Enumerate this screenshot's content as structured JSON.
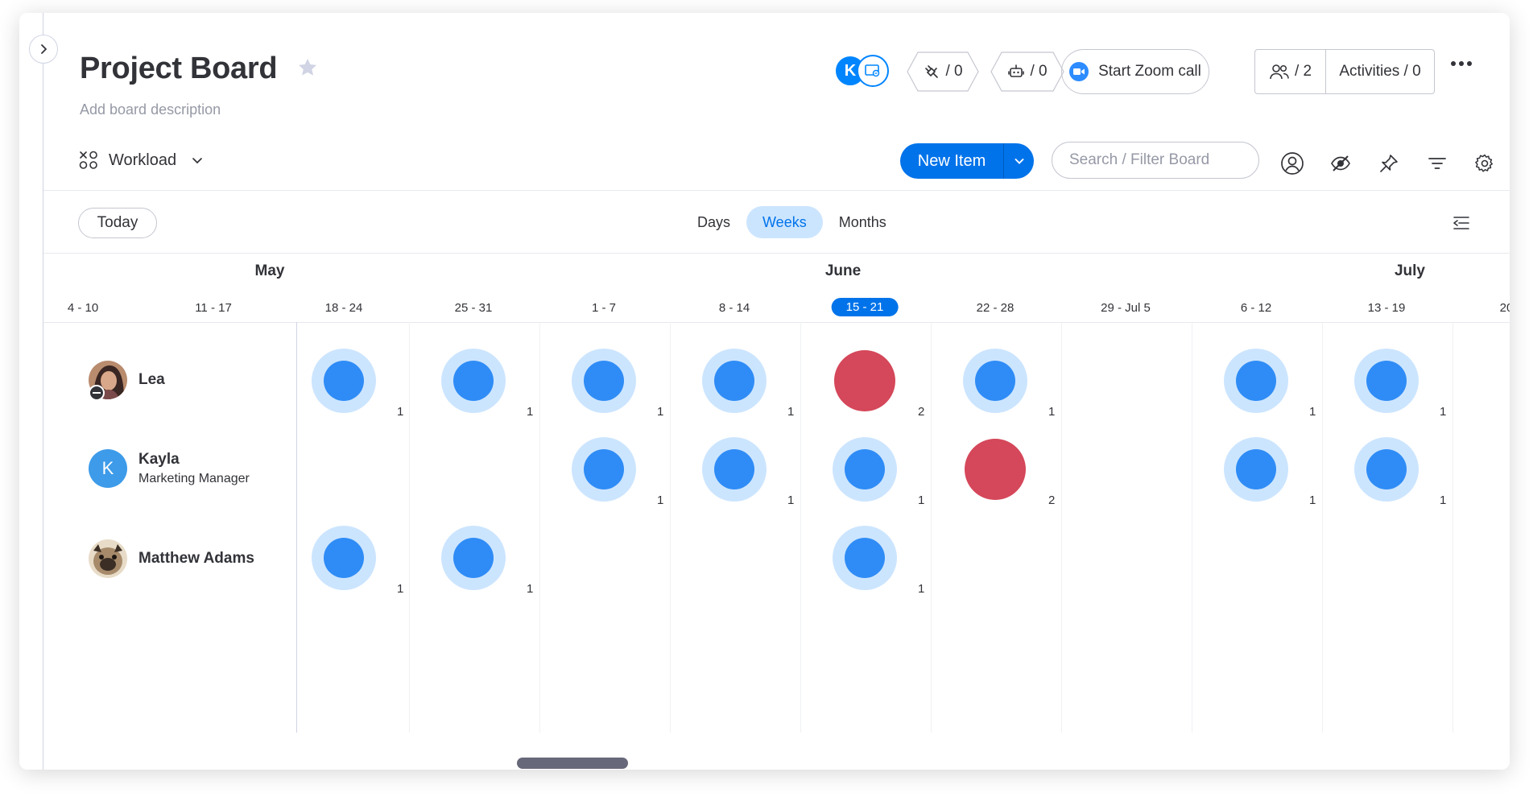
{
  "board": {
    "title": "Project Board",
    "description": "Add board description"
  },
  "header": {
    "avatar_initial": "K",
    "integrations_count": "/ 0",
    "automations_count": "/ 0",
    "zoom_label": "Start Zoom call",
    "members_count": "/ 2",
    "activities_label": "Activities / 0"
  },
  "toolbar": {
    "view_name": "Workload",
    "new_item_label": "New Item",
    "search_placeholder": "Search / Filter Board"
  },
  "timeline": {
    "today_label": "Today",
    "scales": [
      "Days",
      "Weeks",
      "Months"
    ],
    "active_scale": "Weeks",
    "months": [
      "May",
      "June",
      "July"
    ],
    "weeks": [
      "4 - 10",
      "11 - 17",
      "18 - 24",
      "25 - 31",
      "1 - 7",
      "8 - 14",
      "15 - 21",
      "22 - 28",
      "29 - Jul 5",
      "6 - 12",
      "13 - 19",
      "20"
    ],
    "current_week": "15 - 21"
  },
  "people": [
    {
      "name": "Lea",
      "role": "",
      "avatar": "photo",
      "status": "away",
      "workload": [
        null,
        null,
        1,
        1,
        1,
        1,
        2,
        1,
        null,
        1,
        1,
        null
      ]
    },
    {
      "name": "Kayla",
      "role": "Marketing Manager",
      "avatar": "K",
      "workload": [
        null,
        null,
        null,
        null,
        1,
        1,
        1,
        2,
        null,
        1,
        1,
        null
      ]
    },
    {
      "name": "Matthew Adams",
      "role": "",
      "avatar": "photo",
      "workload": [
        null,
        null,
        1,
        1,
        null,
        null,
        1,
        null,
        null,
        null,
        null,
        null
      ]
    }
  ],
  "colors": {
    "primary": "#0073ea",
    "bubble_core": "#2f8cf6",
    "bubble_halo": "#cce5ff",
    "overload": "#d5475a"
  }
}
